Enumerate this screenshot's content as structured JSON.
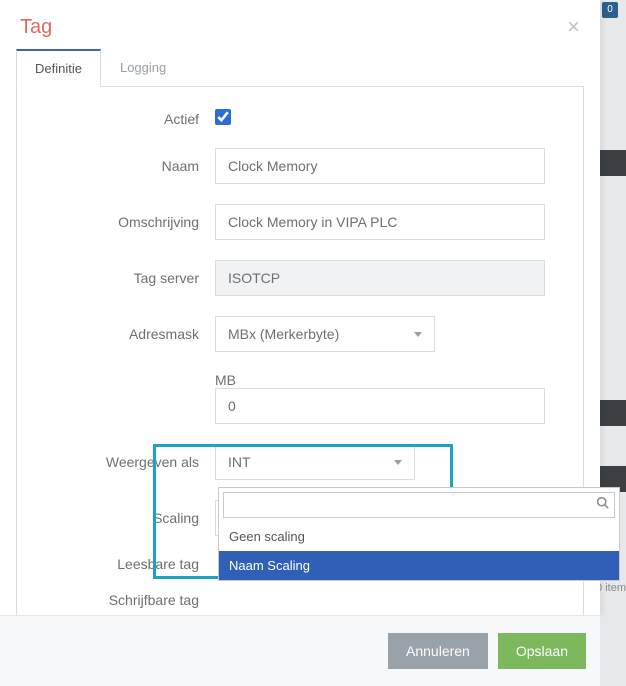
{
  "modal": {
    "title": "Tag",
    "close_aria": "close"
  },
  "tabs": {
    "definition": "Definitie",
    "logging": "Logging"
  },
  "form": {
    "active_label": "Actief",
    "active_checked": true,
    "name_label": "Naam",
    "name_value": "Clock Memory",
    "desc_label": "Omschrijving",
    "desc_value": "Clock Memory in VIPA PLC",
    "tagserver_label": "Tag server",
    "tagserver_value": "ISOTCP",
    "addrmask_label": "Adresmask",
    "addrmask_value": "MBx (Merkerbyte)",
    "mb_sublabel": "MB",
    "mb_value": "0",
    "display_label": "Weergeven als",
    "display_value": "INT",
    "scaling_label": "Scaling",
    "scaling_value": "Naam Scaling",
    "readable_label": "Leesbare tag",
    "writable_label": "Schrijfbare tag"
  },
  "dropdown": {
    "search_placeholder": "",
    "options": {
      "none": "Geen scaling",
      "named": "Naam Scaling"
    }
  },
  "footer": {
    "cancel": "Annuleren",
    "save": "Opslaan"
  },
  "background": {
    "badge_count": "0",
    "items_text": "0 item"
  },
  "colors": {
    "accent_red": "#e46a5e",
    "accent_blue": "#2f5fb6",
    "highlight": "#1fa2bf",
    "save_green": "#7cb85c"
  }
}
